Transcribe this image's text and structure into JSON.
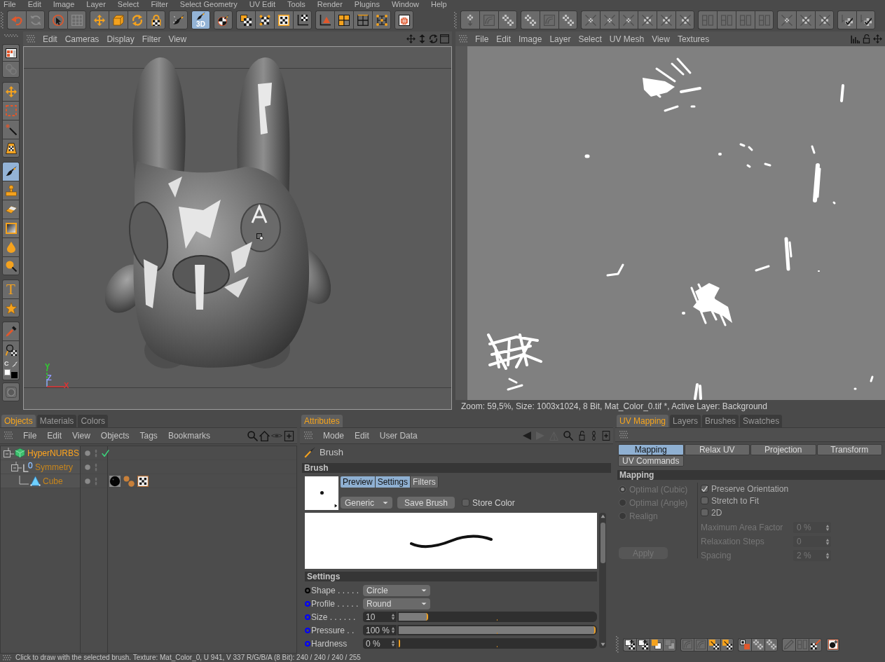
{
  "menu_bar": [
    "File",
    "Edit",
    "Image",
    "Layer",
    "Select",
    "Filter",
    "Select Geometry",
    "UV Edit",
    "Tools",
    "Render",
    "Plugins",
    "Window",
    "Help"
  ],
  "toolbar": {
    "left_groups": [
      [
        {
          "selected": false
        },
        {
          "selected": false
        }
      ],
      [
        {
          "selected": false
        },
        {
          "selected": false
        }
      ],
      [
        {
          "selected": false
        },
        {
          "selected": false
        },
        {
          "selected": false
        },
        {
          "selected": false
        }
      ],
      [
        {
          "selected": false
        }
      ],
      [
        {
          "selected": true,
          "label": "3D"
        }
      ],
      [
        {
          "selected": false
        }
      ],
      [
        {
          "selected": false
        },
        {
          "selected": false
        },
        {
          "selected": false
        },
        {
          "selected": false
        }
      ],
      [
        {
          "selected": false
        },
        {
          "selected": false
        },
        {
          "selected": false
        },
        {
          "selected": false
        }
      ],
      [
        {
          "selected": false
        }
      ]
    ],
    "right_groups": [
      [
        {
          "selected": false
        },
        {
          "selected": false
        },
        {
          "selected": false
        }
      ],
      [
        {
          "selected": false
        },
        {
          "selected": false
        },
        {
          "selected": false
        }
      ],
      [
        {
          "selected": false
        },
        {
          "selected": false
        },
        {
          "selected": false
        },
        {
          "selected": false
        },
        {
          "selected": false
        },
        {
          "selected": false
        }
      ],
      [
        {
          "selected": false
        },
        {
          "selected": false
        },
        {
          "selected": false
        },
        {
          "selected": false
        }
      ],
      [
        {
          "selected": false
        },
        {
          "selected": false
        },
        {
          "selected": false
        }
      ],
      [
        {
          "selected": false
        },
        {
          "selected": false
        }
      ]
    ]
  },
  "tool_palette": {
    "groups": [
      [
        {
          "selected": false
        },
        {
          "selected": false
        }
      ],
      [
        {
          "selected": false
        },
        {
          "selected": false
        },
        {
          "selected": false
        },
        {
          "selected": false
        }
      ],
      [
        {
          "selected": true
        },
        {
          "selected": false
        },
        {
          "selected": false
        },
        {
          "selected": false
        },
        {
          "selected": false
        },
        {
          "selected": false
        }
      ],
      [
        {
          "selected": false,
          "label": "T"
        },
        {
          "selected": false
        }
      ],
      [
        {
          "selected": false
        },
        {
          "selected": false
        }
      ],
      [
        {
          "selected": false
        }
      ]
    ],
    "color_chip": {
      "label": "C",
      "swatches": [
        {
          "color": "#ffffff"
        },
        {
          "color": "#000000"
        }
      ]
    }
  },
  "viewport": {
    "menu": [
      "Edit",
      "Cameras",
      "Display",
      "Filter",
      "View"
    ],
    "axes": [
      {
        "label": "Y",
        "color": "#2ed42e"
      },
      {
        "label": "Z",
        "color": "#8f9bff"
      },
      {
        "label": "X",
        "color": "#e03232"
      }
    ]
  },
  "texture_view": {
    "menu": [
      "File",
      "Edit",
      "Image",
      "Layer",
      "Select",
      "UV Mesh",
      "View",
      "Textures"
    ],
    "status": "Zoom: 59,5%, Size: 1003x1024, 8 Bit, Mat_Color_0.tif *, Active Layer: Background"
  },
  "objects_panel": {
    "tabs": [
      {
        "label": "Objects",
        "selected": true
      },
      {
        "label": "Materials",
        "selected": false
      },
      {
        "label": "Colors",
        "selected": false
      }
    ],
    "menu": [
      "File",
      "Edit",
      "View",
      "Objects",
      "Tags",
      "Bookmarks"
    ],
    "tree": [
      {
        "name": "HyperNURBS",
        "kind": "generator",
        "selected": true,
        "expanded": true,
        "enabled": true,
        "children": [
          {
            "name": "Symmetry",
            "kind": "symmetry",
            "selected": false,
            "expanded": true,
            "enabled": false,
            "children": [
              {
                "name": "Cube",
                "kind": "polygon",
                "selected": false,
                "enabled": false,
                "tags": [
                  {
                    "kind": "material"
                  },
                  {
                    "kind": "phong"
                  },
                  {
                    "kind": "texture"
                  }
                ]
              }
            ]
          }
        ]
      }
    ]
  },
  "attributes_panel": {
    "tabs": [
      {
        "label": "Attributes",
        "selected": true
      }
    ],
    "menu": [
      "Mode",
      "Edit",
      "User Data"
    ],
    "title": "Brush",
    "section": "Brush",
    "mode_tabs": [
      {
        "label": "Preview",
        "selected": true
      },
      {
        "label": "Settings",
        "selected": true
      },
      {
        "label": "Filters",
        "selected": false
      }
    ],
    "preset": "Generic",
    "save_button": "Save Brush",
    "store_color": {
      "label": "Store Color",
      "checked": false
    },
    "settings_title": "Settings",
    "settings": [
      {
        "label": "Shape . . . . .",
        "color": "#000000",
        "kind": "dropdown",
        "value": "Circle"
      },
      {
        "label": "Profile . . . . .",
        "color": "#0000ff",
        "kind": "dropdown",
        "value": "Round"
      },
      {
        "label": "Size . . . . . .",
        "color": "#0000ff",
        "kind": "slider",
        "value": "10",
        "level": 0.15
      },
      {
        "label": "Pressure . .",
        "color": "#0000ff",
        "kind": "slider",
        "value": "100 %",
        "level": 1
      },
      {
        "label": "Hardness",
        "color": "#0000ff",
        "kind": "slider",
        "value": "0 %",
        "level": 0
      }
    ]
  },
  "uv_panel": {
    "tabs": [
      {
        "label": "UV Mapping",
        "selected": true
      },
      {
        "label": "Layers",
        "selected": false
      },
      {
        "label": "Brushes",
        "selected": false
      },
      {
        "label": "Swatches",
        "selected": false
      }
    ],
    "sub_tabs": [
      {
        "label": "Mapping",
        "selected": true
      },
      {
        "label": "Relax UV",
        "selected": false
      },
      {
        "label": "Projection",
        "selected": false
      },
      {
        "label": "Transform",
        "selected": false
      },
      {
        "label": "UV Commands",
        "selected": false
      }
    ],
    "section": "Mapping",
    "methods": [
      {
        "label": "Optimal (Cubic)",
        "selected": true,
        "disabled": true
      },
      {
        "label": "Optimal (Angle)",
        "selected": false,
        "disabled": true
      },
      {
        "label": "Realign",
        "selected": false,
        "disabled": true
      }
    ],
    "apply": {
      "label": "Apply",
      "disabled": true
    },
    "options": [
      {
        "label": "Preserve Orientation",
        "checked": true,
        "disabled": false
      },
      {
        "label": "Stretch to Fit",
        "checked": false,
        "disabled": false
      },
      {
        "label": "2D",
        "checked": false,
        "disabled": false
      }
    ],
    "fields": [
      {
        "label": "Maximum Area Factor",
        "value": "0 %",
        "disabled": true
      },
      {
        "label": "Relaxation Steps",
        "value": "0",
        "disabled": true
      },
      {
        "label": "Spacing",
        "value": "2 %",
        "disabled": true
      }
    ]
  },
  "status_bar": "Click to draw with the selected brush. Texture: Mat_Color_0, U 941, V 337 R/G/B/A (8 Bit): 240 / 240 / 240 / 255"
}
